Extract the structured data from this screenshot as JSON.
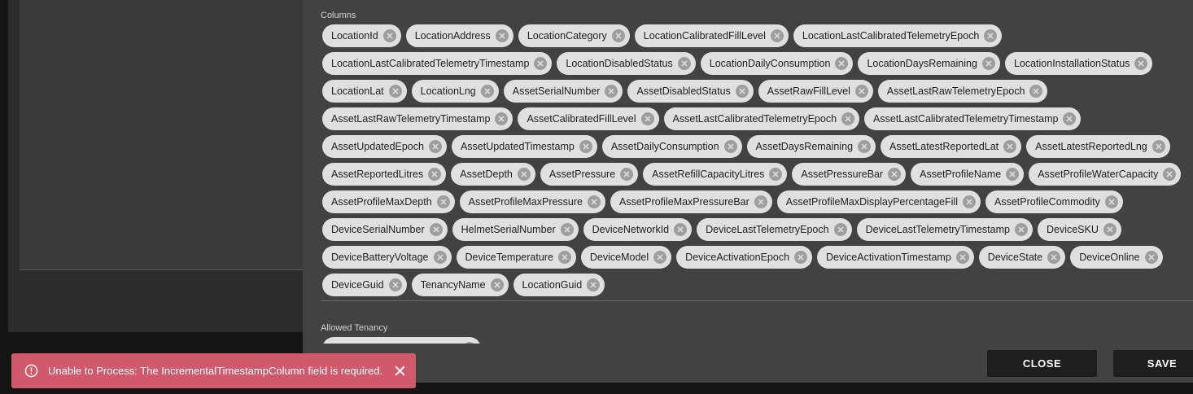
{
  "dialog": {
    "columns_label": "Columns",
    "columns": [
      "LocationId",
      "LocationAddress",
      "LocationCategory",
      "LocationCalibratedFillLevel",
      "LocationLastCalibratedTelemetryEpoch",
      "LocationLastCalibratedTelemetryTimestamp",
      "LocationDisabledStatus",
      "LocationDailyConsumption",
      "LocationDaysRemaining",
      "LocationInstallationStatus",
      "LocationLat",
      "LocationLng",
      "AssetSerialNumber",
      "AssetDisabledStatus",
      "AssetRawFillLevel",
      "AssetLastRawTelemetryEpoch",
      "AssetLastRawTelemetryTimestamp",
      "AssetCalibratedFillLevel",
      "AssetLastCalibratedTelemetryEpoch",
      "AssetLastCalibratedTelemetryTimestamp",
      "AssetUpdatedEpoch",
      "AssetUpdatedTimestamp",
      "AssetDailyConsumption",
      "AssetDaysRemaining",
      "AssetLatestReportedLat",
      "AssetLatestReportedLng",
      "AssetReportedLitres",
      "AssetDepth",
      "AssetPressure",
      "AssetRefillCapacityLitres",
      "AssetPressureBar",
      "AssetProfileName",
      "AssetProfileWaterCapacity",
      "AssetProfileMaxDepth",
      "AssetProfileMaxPressure",
      "AssetProfileMaxPressureBar",
      "AssetProfileMaxDisplayPercentageFill",
      "AssetProfileCommodity",
      "DeviceSerialNumber",
      "HelmetSerialNumber",
      "DeviceNetworkId",
      "DeviceLastTelemetryEpoch",
      "DeviceLastTelemetryTimestamp",
      "DeviceSKU",
      "DeviceBatteryVoltage",
      "DeviceTemperature",
      "DeviceModel",
      "DeviceActivationEpoch",
      "DeviceActivationTimestamp",
      "DeviceState",
      "DeviceOnline",
      "DeviceGuid",
      "TenancyName",
      "LocationGuid"
    ],
    "allowed_tenancy_label": "Allowed Tenancy",
    "close_label": "CLOSE",
    "save_label": "SAVE"
  },
  "toast": {
    "message": "Unable to Process: The IncrementalTimestampColumn field is required.",
    "icon": "error-circle-icon",
    "color": "#d05a6a"
  }
}
